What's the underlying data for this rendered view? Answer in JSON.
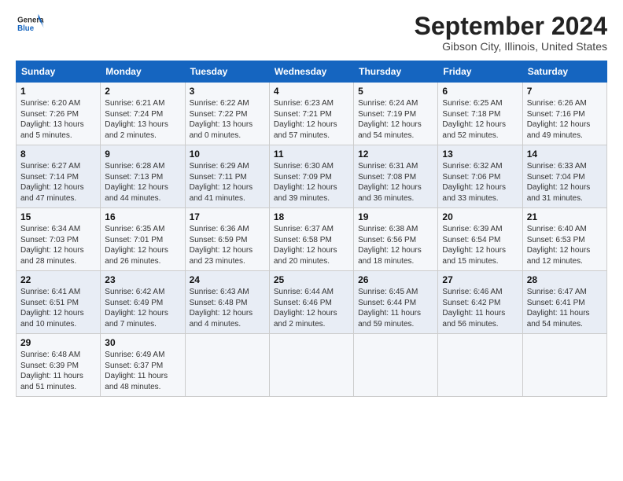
{
  "header": {
    "logo_line1": "General",
    "logo_line2": "Blue",
    "month": "September 2024",
    "location": "Gibson City, Illinois, United States"
  },
  "days_of_week": [
    "Sunday",
    "Monday",
    "Tuesday",
    "Wednesday",
    "Thursday",
    "Friday",
    "Saturday"
  ],
  "weeks": [
    [
      {
        "num": "1",
        "lines": [
          "Sunrise: 6:20 AM",
          "Sunset: 7:26 PM",
          "Daylight: 13 hours",
          "and 5 minutes."
        ]
      },
      {
        "num": "2",
        "lines": [
          "Sunrise: 6:21 AM",
          "Sunset: 7:24 PM",
          "Daylight: 13 hours",
          "and 2 minutes."
        ]
      },
      {
        "num": "3",
        "lines": [
          "Sunrise: 6:22 AM",
          "Sunset: 7:22 PM",
          "Daylight: 13 hours",
          "and 0 minutes."
        ]
      },
      {
        "num": "4",
        "lines": [
          "Sunrise: 6:23 AM",
          "Sunset: 7:21 PM",
          "Daylight: 12 hours",
          "and 57 minutes."
        ]
      },
      {
        "num": "5",
        "lines": [
          "Sunrise: 6:24 AM",
          "Sunset: 7:19 PM",
          "Daylight: 12 hours",
          "and 54 minutes."
        ]
      },
      {
        "num": "6",
        "lines": [
          "Sunrise: 6:25 AM",
          "Sunset: 7:18 PM",
          "Daylight: 12 hours",
          "and 52 minutes."
        ]
      },
      {
        "num": "7",
        "lines": [
          "Sunrise: 6:26 AM",
          "Sunset: 7:16 PM",
          "Daylight: 12 hours",
          "and 49 minutes."
        ]
      }
    ],
    [
      {
        "num": "8",
        "lines": [
          "Sunrise: 6:27 AM",
          "Sunset: 7:14 PM",
          "Daylight: 12 hours",
          "and 47 minutes."
        ]
      },
      {
        "num": "9",
        "lines": [
          "Sunrise: 6:28 AM",
          "Sunset: 7:13 PM",
          "Daylight: 12 hours",
          "and 44 minutes."
        ]
      },
      {
        "num": "10",
        "lines": [
          "Sunrise: 6:29 AM",
          "Sunset: 7:11 PM",
          "Daylight: 12 hours",
          "and 41 minutes."
        ]
      },
      {
        "num": "11",
        "lines": [
          "Sunrise: 6:30 AM",
          "Sunset: 7:09 PM",
          "Daylight: 12 hours",
          "and 39 minutes."
        ]
      },
      {
        "num": "12",
        "lines": [
          "Sunrise: 6:31 AM",
          "Sunset: 7:08 PM",
          "Daylight: 12 hours",
          "and 36 minutes."
        ]
      },
      {
        "num": "13",
        "lines": [
          "Sunrise: 6:32 AM",
          "Sunset: 7:06 PM",
          "Daylight: 12 hours",
          "and 33 minutes."
        ]
      },
      {
        "num": "14",
        "lines": [
          "Sunrise: 6:33 AM",
          "Sunset: 7:04 PM",
          "Daylight: 12 hours",
          "and 31 minutes."
        ]
      }
    ],
    [
      {
        "num": "15",
        "lines": [
          "Sunrise: 6:34 AM",
          "Sunset: 7:03 PM",
          "Daylight: 12 hours",
          "and 28 minutes."
        ]
      },
      {
        "num": "16",
        "lines": [
          "Sunrise: 6:35 AM",
          "Sunset: 7:01 PM",
          "Daylight: 12 hours",
          "and 26 minutes."
        ]
      },
      {
        "num": "17",
        "lines": [
          "Sunrise: 6:36 AM",
          "Sunset: 6:59 PM",
          "Daylight: 12 hours",
          "and 23 minutes."
        ]
      },
      {
        "num": "18",
        "lines": [
          "Sunrise: 6:37 AM",
          "Sunset: 6:58 PM",
          "Daylight: 12 hours",
          "and 20 minutes."
        ]
      },
      {
        "num": "19",
        "lines": [
          "Sunrise: 6:38 AM",
          "Sunset: 6:56 PM",
          "Daylight: 12 hours",
          "and 18 minutes."
        ]
      },
      {
        "num": "20",
        "lines": [
          "Sunrise: 6:39 AM",
          "Sunset: 6:54 PM",
          "Daylight: 12 hours",
          "and 15 minutes."
        ]
      },
      {
        "num": "21",
        "lines": [
          "Sunrise: 6:40 AM",
          "Sunset: 6:53 PM",
          "Daylight: 12 hours",
          "and 12 minutes."
        ]
      }
    ],
    [
      {
        "num": "22",
        "lines": [
          "Sunrise: 6:41 AM",
          "Sunset: 6:51 PM",
          "Daylight: 12 hours",
          "and 10 minutes."
        ]
      },
      {
        "num": "23",
        "lines": [
          "Sunrise: 6:42 AM",
          "Sunset: 6:49 PM",
          "Daylight: 12 hours",
          "and 7 minutes."
        ]
      },
      {
        "num": "24",
        "lines": [
          "Sunrise: 6:43 AM",
          "Sunset: 6:48 PM",
          "Daylight: 12 hours",
          "and 4 minutes."
        ]
      },
      {
        "num": "25",
        "lines": [
          "Sunrise: 6:44 AM",
          "Sunset: 6:46 PM",
          "Daylight: 12 hours",
          "and 2 minutes."
        ]
      },
      {
        "num": "26",
        "lines": [
          "Sunrise: 6:45 AM",
          "Sunset: 6:44 PM",
          "Daylight: 11 hours",
          "and 59 minutes."
        ]
      },
      {
        "num": "27",
        "lines": [
          "Sunrise: 6:46 AM",
          "Sunset: 6:42 PM",
          "Daylight: 11 hours",
          "and 56 minutes."
        ]
      },
      {
        "num": "28",
        "lines": [
          "Sunrise: 6:47 AM",
          "Sunset: 6:41 PM",
          "Daylight: 11 hours",
          "and 54 minutes."
        ]
      }
    ],
    [
      {
        "num": "29",
        "lines": [
          "Sunrise: 6:48 AM",
          "Sunset: 6:39 PM",
          "Daylight: 11 hours",
          "and 51 minutes."
        ]
      },
      {
        "num": "30",
        "lines": [
          "Sunrise: 6:49 AM",
          "Sunset: 6:37 PM",
          "Daylight: 11 hours",
          "and 48 minutes."
        ]
      },
      {
        "num": "",
        "lines": []
      },
      {
        "num": "",
        "lines": []
      },
      {
        "num": "",
        "lines": []
      },
      {
        "num": "",
        "lines": []
      },
      {
        "num": "",
        "lines": []
      }
    ]
  ]
}
